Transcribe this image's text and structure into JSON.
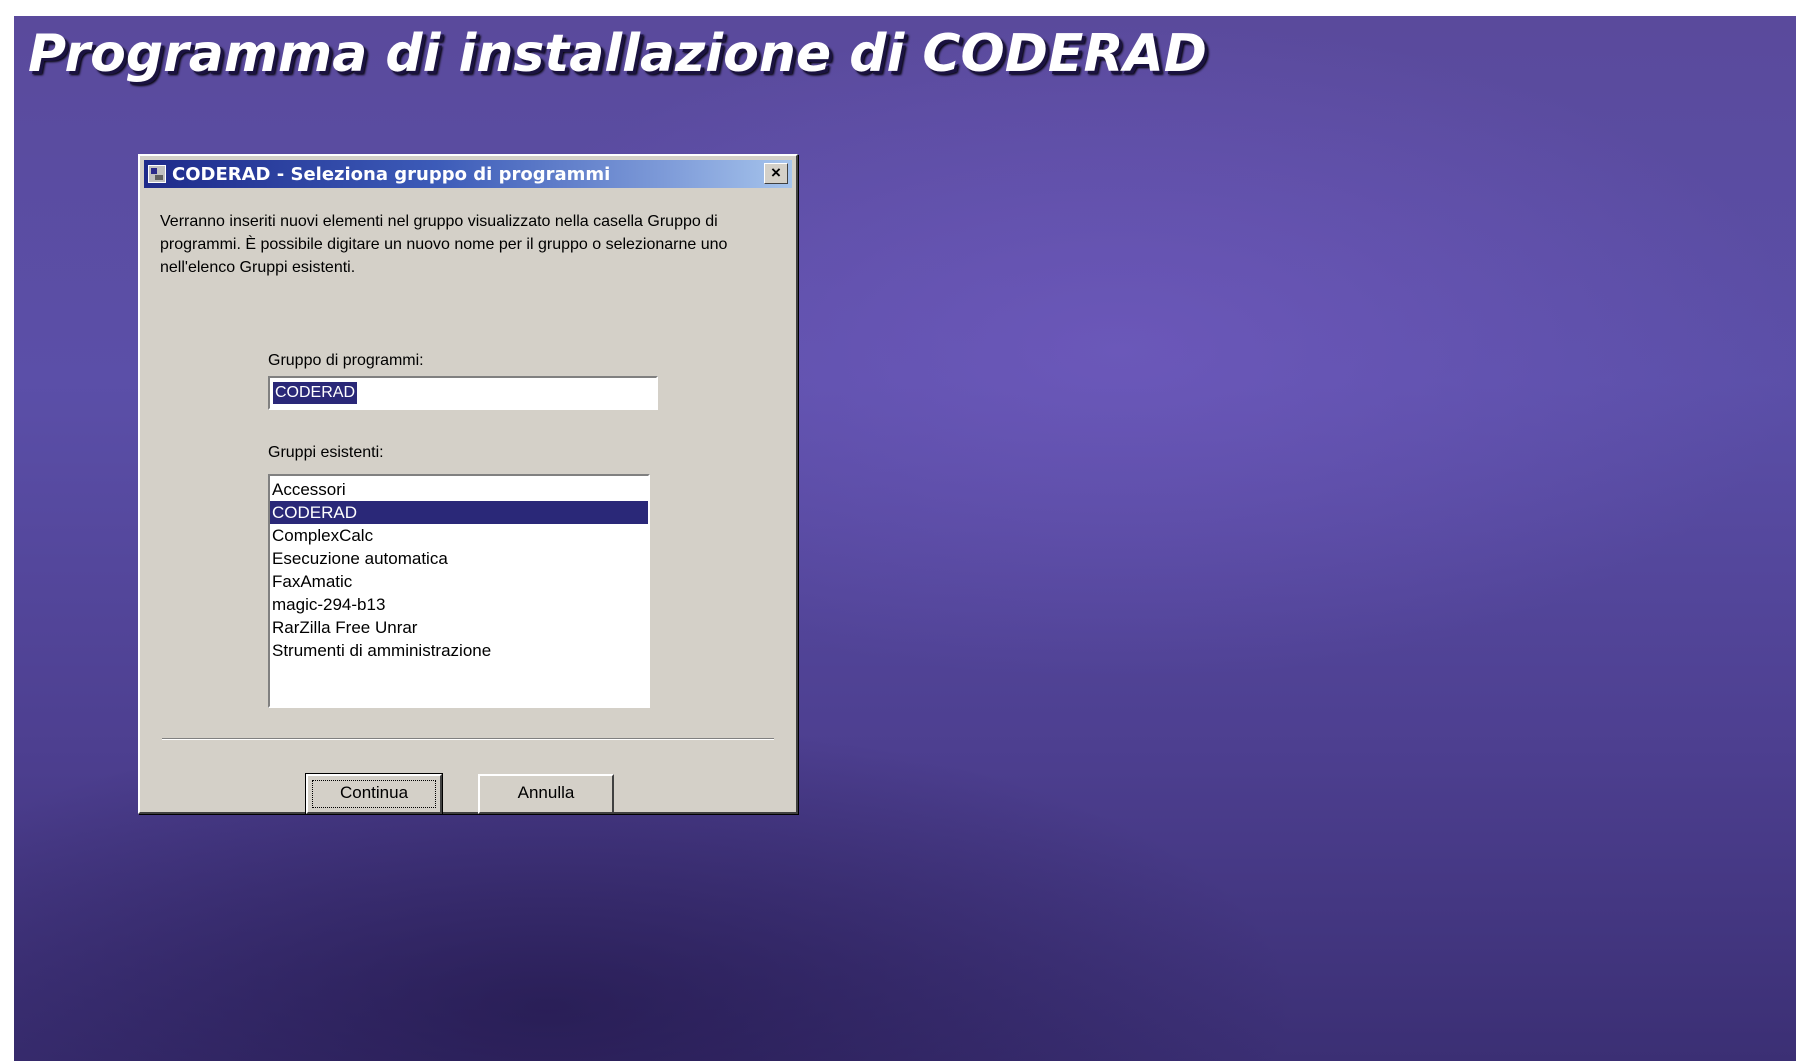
{
  "page": {
    "title": "Programma di installazione di CODERAD"
  },
  "dialog": {
    "title": "CODERAD - Seleziona gruppo di programmi",
    "close_glyph": "×",
    "description": "Verranno inseriti nuovi elementi nel gruppo visualizzato nella casella Gruppo di programmi. È possibile digitare un nuovo nome per il gruppo o selezionarne uno nell'elenco Gruppi esistenti.",
    "group_label": "Gruppo di programmi:",
    "group_value": "CODERAD",
    "existing_label": "Gruppi esistenti:",
    "existing_groups": [
      "Accessori",
      "CODERAD",
      "ComplexCalc",
      "Esecuzione automatica",
      "FaxAmatic",
      "magic-294-b13",
      "RarZilla Free Unrar",
      "Strumenti di amministrazione"
    ],
    "selected_group": "CODERAD",
    "continue_label": "Continua",
    "cancel_label": "Annulla"
  },
  "colors": {
    "desktop": "#5b4fa8",
    "titlebar_start": "#1e2a8a",
    "titlebar_end": "#a6c4ec",
    "selection": "#2a2878",
    "dialog_face": "#d4d0c8"
  },
  "icons": {
    "app": "installer-app-icon",
    "close": "close-icon"
  }
}
